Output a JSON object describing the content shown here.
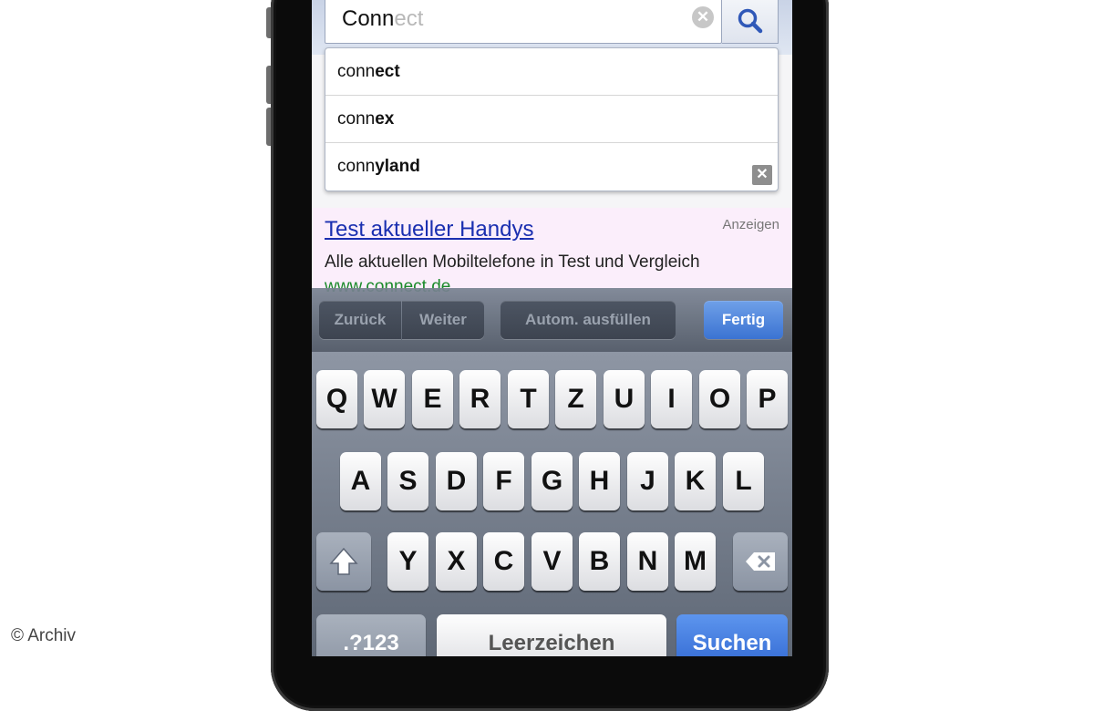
{
  "search": {
    "typed": "Conn",
    "completion": "ect",
    "clear_icon": "✕",
    "search_icon": "magnifier-icon"
  },
  "suggestions": [
    {
      "prefix": "conn",
      "rest": "ect"
    },
    {
      "prefix": "conn",
      "rest": "ex"
    },
    {
      "prefix": "conn",
      "rest": "yland"
    }
  ],
  "suggest_close": "✕",
  "ad": {
    "title": "Test aktueller Handys",
    "label": "Anzeigen",
    "description": "Alle aktuellen Mobiltelefone in Test und Vergleich",
    "url": "www.connect.de"
  },
  "toolbar": {
    "back": "Zurück",
    "next": "Weiter",
    "autofill": "Autom. ausfüllen",
    "done": "Fertig"
  },
  "keyboard": {
    "row1": [
      "Q",
      "W",
      "E",
      "R",
      "T",
      "Z",
      "U",
      "I",
      "O",
      "P"
    ],
    "row2": [
      "A",
      "S",
      "D",
      "F",
      "G",
      "H",
      "J",
      "K",
      "L"
    ],
    "row3": [
      "Y",
      "X",
      "C",
      "V",
      "B",
      "N",
      "M"
    ],
    "numbers": ".?123",
    "space": "Leerzeichen",
    "go": "Suchen"
  },
  "watermark": "© Archiv"
}
